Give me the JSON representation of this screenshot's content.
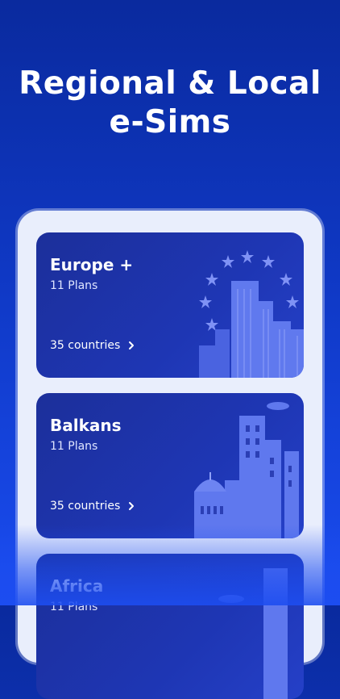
{
  "headline": {
    "line1": "Regional & Local",
    "line2": "e-Sims"
  },
  "cards": [
    {
      "title": "Europe +",
      "plans": "11 Plans",
      "countries": "35 countries"
    },
    {
      "title": "Balkans",
      "plans": "11 Plans",
      "countries": "35 countries"
    },
    {
      "title": "Africa",
      "plans": "11 Plans",
      "countries": ""
    }
  ],
  "icons": {
    "chevron": "chevron-right-icon",
    "stars": "eu-stars-icon"
  },
  "colors": {
    "background": "#0f38c4",
    "card": "#1e36b4",
    "frame": "#e9eefc",
    "accent_art": "#5b74f0"
  }
}
